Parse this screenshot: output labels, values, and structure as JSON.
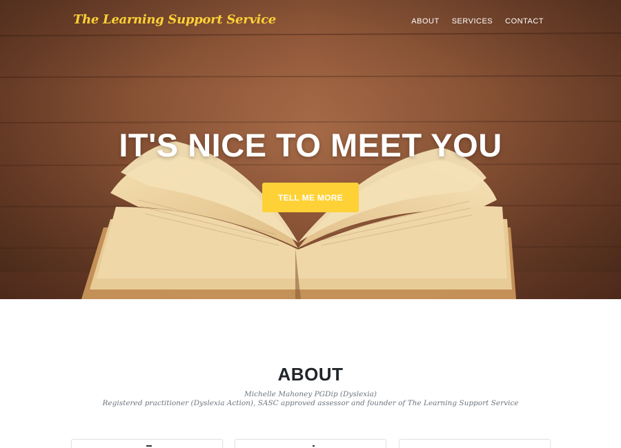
{
  "navbar": {
    "brand": "The Learning Support Service",
    "links": [
      {
        "label": "ABOUT"
      },
      {
        "label": "SERVICES"
      },
      {
        "label": "CONTACT"
      }
    ]
  },
  "hero": {
    "heading": "IT'S NICE TO MEET YOU",
    "cta_label": "TELL ME MORE",
    "image": "open-book-on-wooden-table"
  },
  "about": {
    "title": "ABOUT",
    "subtitle_line1": "Michelle Mahoney PGDip (Dyslexia)",
    "subtitle_line2": "Registered practitioner (Dyslexia Action), SASC approved assessor and founder of The Learning Support Service"
  },
  "colors": {
    "accent": "#fed136",
    "heading_dark": "#212529",
    "muted_text": "#6c757d",
    "wood": "#8f5637"
  }
}
